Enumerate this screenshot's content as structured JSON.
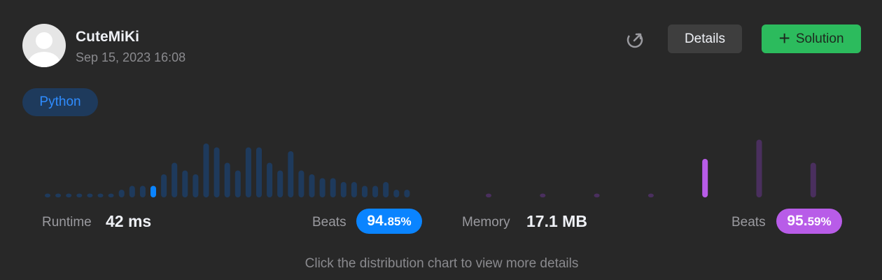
{
  "user": {
    "name": "CuteMiKi",
    "timestamp": "Sep 15, 2023 16:08"
  },
  "actions": {
    "details_label": "Details",
    "solution_label": "Solution"
  },
  "language": "Python",
  "runtime": {
    "label": "Runtime",
    "value": "42 ms",
    "beats_label": "Beats",
    "beats_int": "94.",
    "beats_frac": "85%"
  },
  "memory": {
    "label": "Memory",
    "value": "17.1 MB",
    "beats_label": "Beats",
    "beats_int": "95.",
    "beats_frac": "59%"
  },
  "hint": "Click the distribution chart to view more details",
  "colors": {
    "runtime_bar": "#1e3a5c",
    "runtime_highlight": "#0a84ff",
    "memory_bar": "#4a2f5e",
    "memory_highlight": "#b85ce8",
    "accent_green": "#2cbb5d"
  },
  "chart_data": [
    {
      "type": "bar",
      "series": [
        {
          "values": [
            1,
            1,
            1,
            1,
            1,
            1,
            1,
            2,
            3,
            3,
            3,
            6,
            9,
            7,
            6,
            14,
            13,
            9,
            7,
            13,
            13,
            9,
            7,
            12,
            7,
            6,
            5,
            5,
            4,
            4,
            3,
            3,
            4,
            2,
            2
          ]
        }
      ],
      "highlight_index": 10
    },
    {
      "type": "bar",
      "series": [
        {
          "values": [
            1,
            1,
            1,
            1,
            10,
            15,
            9
          ]
        }
      ],
      "highlight_index": 4
    }
  ]
}
